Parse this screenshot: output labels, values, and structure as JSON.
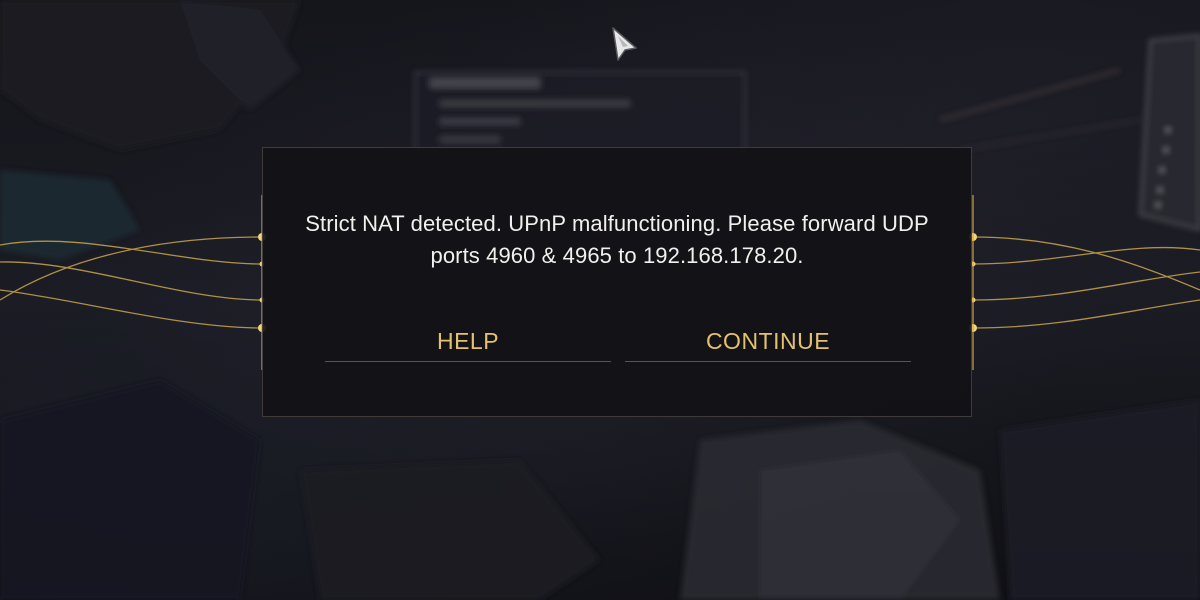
{
  "dialog": {
    "message": "Strict NAT detected. UPnP malfunctioning. Please forward UDP ports 4960 & 4965 to 192.168.178.20.",
    "help_label": "HELP",
    "continue_label": "CONTINUE"
  },
  "colors": {
    "accent_gold": "#e3c16f",
    "text": "#f2f0ec",
    "dialog_bg": "#121116"
  },
  "icons": {
    "cursor": "pointer-cursor-icon"
  }
}
